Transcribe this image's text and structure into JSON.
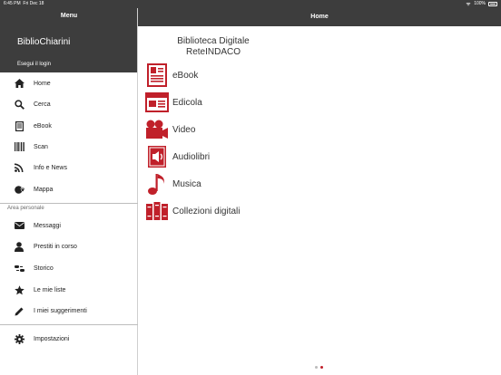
{
  "status": {
    "time": "6:45 PM",
    "date": "Fri Dec 18",
    "battery": "100%"
  },
  "sidebar": {
    "title": "Menu",
    "app_name": "BiblioChiarini",
    "login": "Esegui il login",
    "items": [
      {
        "label": "Home",
        "icon": "home-icon"
      },
      {
        "label": "Cerca",
        "icon": "search-icon"
      },
      {
        "label": "eBook",
        "icon": "ebook-icon"
      },
      {
        "label": "Scan",
        "icon": "barcode-icon"
      },
      {
        "label": "Info e News",
        "icon": "rss-icon"
      },
      {
        "label": "Mappa",
        "icon": "map-icon"
      }
    ],
    "section_label": "Area personale",
    "personal_items": [
      {
        "label": "Messaggi",
        "icon": "envelope-icon"
      },
      {
        "label": "Prestiti in corso",
        "icon": "user-icon"
      },
      {
        "label": "Storico",
        "icon": "history-icon"
      },
      {
        "label": "Le mie liste",
        "icon": "star-icon"
      },
      {
        "label": "I miei suggerimenti",
        "icon": "pencil-icon"
      }
    ],
    "settings": {
      "label": "Impostazioni",
      "icon": "gear-icon"
    }
  },
  "header": {
    "title": "Home"
  },
  "main": {
    "library_title_line1": "Biblioteca Digitale",
    "library_title_line2": "ReteINDACO",
    "categories": [
      {
        "label": "eBook",
        "icon": "ebook-icon"
      },
      {
        "label": "Edicola",
        "icon": "newspaper-icon"
      },
      {
        "label": "Video",
        "icon": "video-camera-icon"
      },
      {
        "label": "Audiolibri",
        "icon": "audiobook-icon"
      },
      {
        "label": "Musica",
        "icon": "music-note-icon"
      },
      {
        "label": "Collezioni digitali",
        "icon": "collections-icon"
      }
    ]
  },
  "pager": {
    "pages": 2,
    "current": 2
  },
  "colors": {
    "bar": "#3d3d3d",
    "accent": "#c0202a",
    "text": "#333333"
  }
}
